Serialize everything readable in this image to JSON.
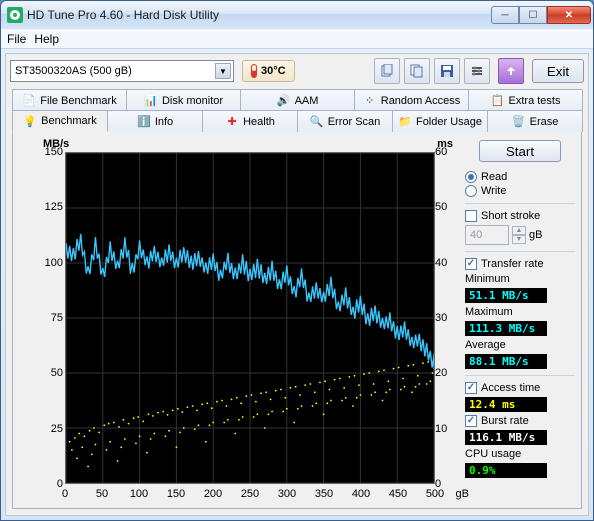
{
  "window": {
    "title": "HD Tune Pro 4.60 - Hard Disk Utility"
  },
  "menu": {
    "file": "File",
    "help": "Help"
  },
  "toolbar": {
    "drive": "ST3500320AS (500 gB)",
    "temperature": "30°C",
    "exit": "Exit"
  },
  "tabs_top": [
    {
      "label": "File Benchmark",
      "icon": "file-benchmark-icon"
    },
    {
      "label": "Disk monitor",
      "icon": "disk-monitor-icon"
    },
    {
      "label": "AAM",
      "icon": "aam-icon"
    },
    {
      "label": "Random Access",
      "icon": "random-access-icon"
    },
    {
      "label": "Extra tests",
      "icon": "extra-tests-icon"
    }
  ],
  "tabs_bottom": [
    {
      "label": "Benchmark",
      "icon": "benchmark-icon",
      "active": true
    },
    {
      "label": "Info",
      "icon": "info-icon"
    },
    {
      "label": "Health",
      "icon": "health-icon"
    },
    {
      "label": "Error Scan",
      "icon": "error-scan-icon"
    },
    {
      "label": "Folder Usage",
      "icon": "folder-usage-icon"
    },
    {
      "label": "Erase",
      "icon": "erase-icon"
    }
  ],
  "side": {
    "start": "Start",
    "read": "Read",
    "write": "Write",
    "short_stroke": "Short stroke",
    "short_stroke_value": "40",
    "short_stroke_unit": "gB",
    "transfer_rate": "Transfer rate",
    "minimum_label": "Minimum",
    "minimum_value": "51.1 MB/s",
    "maximum_label": "Maximum",
    "maximum_value": "111.3 MB/s",
    "average_label": "Average",
    "average_value": "88.1 MB/s",
    "access_time_label": "Access time",
    "access_time_value": "12.4 ms",
    "burst_rate_label": "Burst rate",
    "burst_rate_value": "116.1 MB/s",
    "cpu_usage_label": "CPU usage",
    "cpu_usage_value": "0.9%"
  },
  "axes": {
    "left_unit": "MB/s",
    "right_unit": "ms",
    "x_unit": "gB",
    "left_ticks": [
      "150",
      "125",
      "100",
      "75",
      "50",
      "25",
      "0"
    ],
    "right_ticks": [
      "60",
      "50",
      "40",
      "30",
      "20",
      "10",
      "0"
    ],
    "x_ticks": [
      "0",
      "50",
      "100",
      "150",
      "200",
      "250",
      "300",
      "350",
      "400",
      "450",
      "500"
    ]
  },
  "chart_data": {
    "type": "line",
    "title": "Benchmark",
    "xlabel": "gB",
    "ylabel_left": "MB/s",
    "ylabel_right": "ms",
    "xlim": [
      0,
      500
    ],
    "ylim_left": [
      0,
      150
    ],
    "ylim_right": [
      0,
      60
    ],
    "series": [
      {
        "name": "Transfer rate (MB/s)",
        "axis": "left",
        "color": "#38c6ff",
        "x": [
          0,
          10,
          20,
          30,
          40,
          50,
          60,
          70,
          80,
          90,
          100,
          110,
          120,
          130,
          140,
          150,
          160,
          170,
          180,
          190,
          200,
          210,
          220,
          230,
          240,
          250,
          260,
          270,
          280,
          290,
          300,
          310,
          320,
          330,
          340,
          350,
          360,
          370,
          380,
          390,
          400,
          410,
          420,
          430,
          440,
          450,
          460,
          470,
          480,
          490,
          500
        ],
        "values": [
          106,
          104,
          110,
          95,
          108,
          94,
          106,
          98,
          108,
          96,
          107,
          100,
          105,
          100,
          105,
          100,
          104,
          100,
          103,
          97,
          101,
          94,
          101,
          94,
          100,
          94,
          98,
          93,
          97,
          90,
          96,
          86,
          94,
          84,
          88,
          84,
          90,
          80,
          85,
          77,
          82,
          74,
          78,
          72,
          74,
          68,
          70,
          64,
          65,
          60,
          55
        ]
      },
      {
        "name": "Access time (ms)",
        "axis": "right",
        "color": "#ffff00",
        "type": "scatter",
        "x": [
          5,
          12,
          18,
          25,
          32,
          38,
          45,
          52,
          58,
          65,
          72,
          78,
          85,
          92,
          98,
          105,
          112,
          118,
          125,
          132,
          138,
          145,
          152,
          158,
          165,
          172,
          178,
          185,
          192,
          198,
          205,
          212,
          218,
          225,
          232,
          238,
          245,
          252,
          258,
          265,
          272,
          278,
          285,
          292,
          298,
          305,
          312,
          318,
          325,
          332,
          338,
          345,
          352,
          358,
          365,
          372,
          378,
          385,
          392,
          398,
          405,
          412,
          418,
          425,
          432,
          438,
          445,
          452,
          458,
          465,
          472,
          478,
          485,
          492,
          498,
          8,
          22,
          40,
          60,
          80,
          100,
          120,
          140,
          160,
          180,
          200,
          220,
          240,
          260,
          280,
          300,
          320,
          340,
          360,
          380,
          400,
          420,
          440,
          460,
          480,
          495,
          15,
          35,
          55,
          75,
          95,
          115,
          135,
          155,
          175,
          195,
          215,
          235,
          255,
          275,
          295,
          315,
          335,
          355,
          375,
          395,
          415,
          435,
          455,
          475,
          490,
          30,
          70,
          110,
          150,
          190,
          230,
          270,
          310,
          350,
          390,
          430,
          470
        ],
        "values": [
          7.5,
          8.2,
          9.0,
          8.5,
          9.5,
          10.0,
          9.2,
          10.5,
          10.8,
          11.0,
          10.2,
          11.5,
          10.8,
          11.8,
          12.0,
          11.2,
          12.5,
          12.2,
          12.8,
          13.0,
          12.4,
          13.2,
          13.5,
          12.9,
          13.8,
          14.0,
          13.2,
          14.3,
          14.5,
          13.6,
          14.8,
          15.0,
          14.0,
          15.2,
          15.5,
          14.5,
          15.8,
          16.0,
          14.8,
          16.3,
          16.5,
          15.2,
          16.8,
          17.0,
          15.5,
          17.3,
          17.5,
          16.0,
          17.8,
          18.0,
          16.5,
          18.3,
          18.5,
          17.0,
          18.8,
          19.0,
          17.3,
          19.3,
          19.5,
          17.8,
          19.8,
          20.0,
          18.0,
          20.3,
          20.5,
          18.5,
          20.8,
          21.0,
          19.0,
          21.3,
          21.5,
          19.5,
          21.8,
          22.0,
          20.0,
          6.0,
          6.5,
          7.0,
          7.5,
          8.0,
          8.5,
          9.0,
          9.5,
          10.0,
          10.5,
          11.0,
          11.5,
          12.0,
          12.5,
          13.0,
          13.5,
          14.0,
          14.5,
          15.0,
          15.5,
          16.0,
          16.5,
          17.0,
          17.5,
          18.0,
          18.5,
          4.5,
          5.2,
          6.0,
          6.5,
          7.2,
          8.0,
          8.5,
          9.2,
          9.8,
          10.5,
          11.0,
          11.5,
          12.0,
          12.5,
          13.0,
          13.5,
          14.0,
          14.5,
          15.0,
          15.5,
          16.0,
          16.5,
          17.0,
          17.5,
          18.0,
          3.0,
          4.0,
          5.5,
          6.5,
          7.5,
          9.0,
          10.0,
          11.0,
          12.5,
          14.0,
          15.0,
          16.5
        ]
      }
    ]
  },
  "colors": {
    "chart_bg": "#000000",
    "transfer": "#38c6ff",
    "access": "#ffff00",
    "grid": "#333333"
  }
}
